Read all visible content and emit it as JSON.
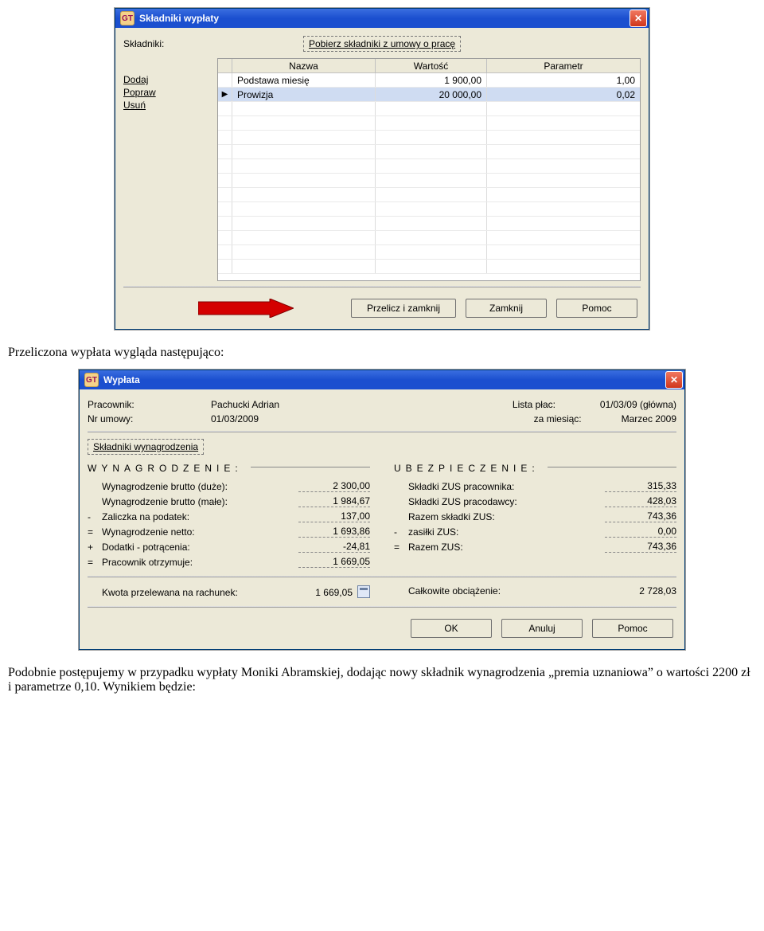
{
  "window1": {
    "title": "Składniki wypłaty",
    "labels": {
      "skladniki": "Składniki:",
      "pobierz": "Pobierz składniki z umowy o pracę"
    },
    "sideActions": {
      "dodaj": "Dodaj",
      "popraw": "Popraw",
      "usun": "Usuń"
    },
    "grid": {
      "headers": {
        "nazwa": "Nazwa",
        "wartosc": "Wartość",
        "parametr": "Parametr"
      },
      "rows": [
        {
          "nazwa": "Podstawa miesię",
          "wartosc": "1 900,00",
          "parametr": "1,00",
          "selected": false
        },
        {
          "nazwa": "Prowizja",
          "wartosc": "20 000,00",
          "parametr": "0,02",
          "selected": true
        }
      ]
    },
    "buttons": {
      "przelicz": "Przelicz i zamknij",
      "zamknij": "Zamknij",
      "pomoc": "Pomoc"
    }
  },
  "paragraph1": "Przeliczona wypłata wygląda następująco:",
  "window2": {
    "title": "Wypłata",
    "header": {
      "pracownik_lbl": "Pracownik:",
      "pracownik_val": "Pachucki Adrian",
      "lista_lbl": "Lista płac:",
      "lista_val": "01/03/09 (główna)",
      "nrumowy_lbl": "Nr umowy:",
      "nrumowy_val": "01/03/2009",
      "zamies_lbl": "za miesiąc:",
      "zamies_val": "Marzec 2009"
    },
    "skladniki_label": "Składniki wynagrodzenia",
    "section_left": "WYNAGRODZENIE:",
    "section_right": "UBEZPIECZENIE:",
    "left_rows": [
      {
        "op": "",
        "label": "Wynagrodzenie brutto (duże):",
        "value": "2 300,00"
      },
      {
        "op": "",
        "label": "Wynagrodzenie brutto (małe):",
        "value": "1 984,67"
      },
      {
        "op": "-",
        "label": "Zaliczka na podatek:",
        "value": "137,00"
      },
      {
        "op": "=",
        "label": "Wynagrodzenie netto:",
        "value": "1 693,86"
      },
      {
        "op": "+",
        "label": "Dodatki - potrącenia:",
        "value": "-24,81"
      },
      {
        "op": "=",
        "label": "Pracownik otrzymuje:",
        "value": "1 669,05"
      }
    ],
    "right_rows": [
      {
        "op": "",
        "label": "Składki ZUS pracownika:",
        "value": "315,33"
      },
      {
        "op": "",
        "label": "Składki ZUS pracodawcy:",
        "value": "428,03"
      },
      {
        "op": "",
        "label": "Razem składki ZUS:",
        "value": "743,36"
      },
      {
        "op": "-",
        "label": "zasiłki ZUS:",
        "value": "0,00"
      },
      {
        "op": "=",
        "label": "Razem ZUS:",
        "value": "743,36"
      }
    ],
    "footer": {
      "kwota_lbl": "Kwota przelewana na rachunek:",
      "kwota_val": "1 669,05",
      "obc_lbl": "Całkowite obciążenie:",
      "obc_val": "2 728,03"
    },
    "buttons": {
      "ok": "OK",
      "anuluj": "Anuluj",
      "pomoc": "Pomoc"
    }
  },
  "paragraph2": "Podobnie postępujemy w przypadku wypłaty Moniki Abramskiej, dodając nowy składnik wynagrodzenia „premia uznaniowa” o wartości 2200 zł i parametrze 0,10. Wynikiem będzie:"
}
